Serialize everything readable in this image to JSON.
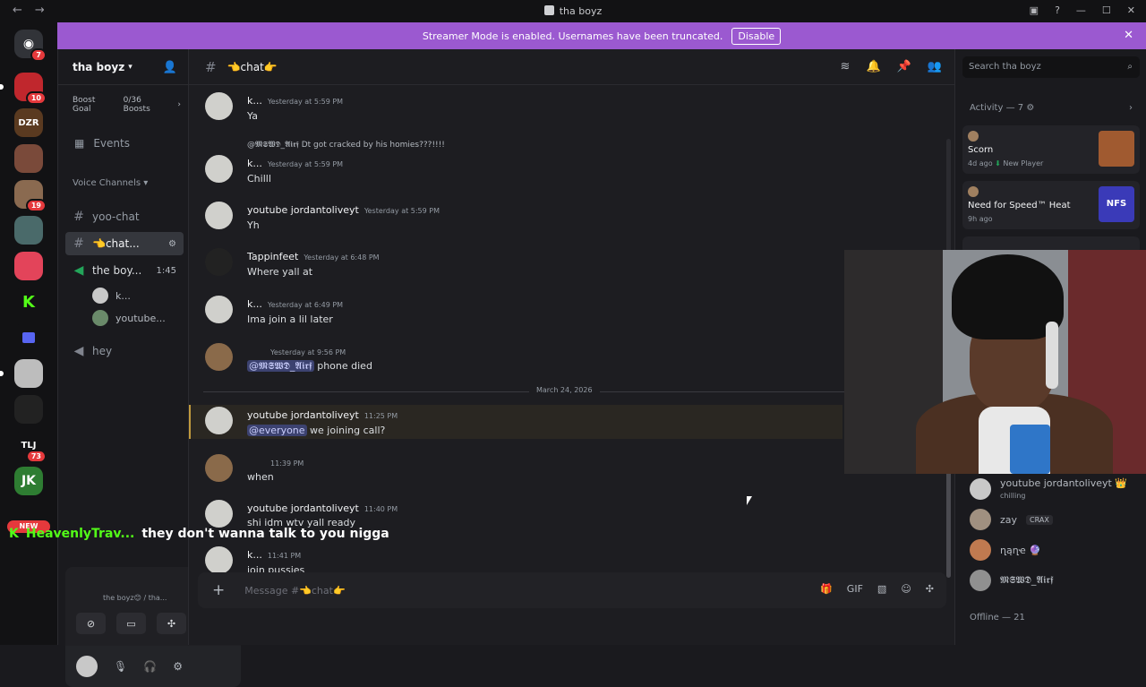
{
  "window": {
    "title": "tha boyz"
  },
  "banner": {
    "text": "Streamer Mode is enabled. Usernames have been truncated.",
    "disable_label": "Disable"
  },
  "rail": {
    "badges": [
      "7",
      "10",
      "19",
      "73"
    ],
    "new_label": "NEW",
    "tile_labels": [
      "DZR",
      "TLJ",
      "JK"
    ]
  },
  "server": {
    "name": "tha boyz",
    "boost_goal": "Boost Goal",
    "boost_count": "0/36 Boosts",
    "events_label": "Events",
    "voice_category": "Voice Channels",
    "channels": [
      {
        "name": "yoo-chat"
      },
      {
        "name": "👈chat..."
      },
      {
        "name": "the boy...",
        "time": "1:45"
      },
      {
        "name": "hey"
      }
    ],
    "voice_users": [
      "k...",
      "youtube..."
    ]
  },
  "voice_panel": {
    "location": "the boyz😊 / tha..."
  },
  "chat": {
    "channel": "👈chat👉",
    "composer_placeholder": "Message #👈chat👉",
    "date_divider": "March 24, 2026",
    "messages": [
      {
        "author": "k...",
        "time": "Yesterday at 5:59 PM",
        "text": "Ya"
      },
      {
        "reply": "@𝕸𝕾𝖂𝕯_𝕬𝖎𝖗𝖋 Dt got cracked by his homies???!!!!",
        "author": "k...",
        "time": "Yesterday at 5:59 PM",
        "text": "Chilll"
      },
      {
        "author": "youtube jordantoliveyt",
        "time": "Yesterday at 5:59 PM",
        "text": "Yh"
      },
      {
        "author": "Tappinfeet",
        "time": "Yesterday at 6:48 PM",
        "text": "Where yall at"
      },
      {
        "author": "k...",
        "time": "Yesterday at 6:49 PM",
        "text": "Ima join a lil later"
      },
      {
        "author": "",
        "time": "Yesterday at 9:56 PM",
        "mention": "@𝕸𝕾𝖂𝕯_𝕬𝖎𝖗𝖋",
        "text": " phone died"
      },
      {
        "author": "youtube jordantoliveyt",
        "time": "11:25 PM",
        "mention": "@everyone",
        "text": " we joining call?"
      },
      {
        "author": "",
        "time": "11:39 PM",
        "text": "when"
      },
      {
        "author": "youtube jordantoliveyt",
        "time": "11:40 PM",
        "text": "shi idm wtv yall ready"
      },
      {
        "author": "k...",
        "time": "11:41 PM",
        "text": "join pussies"
      }
    ]
  },
  "members": {
    "search_placeholder": "Search tha boyz",
    "activity_header": "Activity — 7",
    "activities": [
      {
        "game": "Scorn",
        "meta": "4d ago",
        "tag": "New Player"
      },
      {
        "game": "Need for Speed™ Heat",
        "meta": "9h ago",
        "thumb_text": "NFS"
      }
    ],
    "list": [
      {
        "name": "youtube jordantoliveyt 👑",
        "status": "chilling"
      },
      {
        "name": "zay",
        "tag": "CRAX"
      },
      {
        "name": "ղąղҽ 🔮"
      },
      {
        "name": "𝕸𝕾𝖂𝕯_𝕬𝖎𝖗𝖋"
      }
    ],
    "offline_header": "Offline — 21"
  },
  "stream_overlay": {
    "username": "HeavenlyTrav...",
    "message": "they don't wanna talk to you nigga"
  },
  "colors": {
    "banner": "#9b59d0",
    "mention_bg": "#3c4270",
    "kick_green": "#53fc18",
    "badge_red": "#e5393c"
  }
}
